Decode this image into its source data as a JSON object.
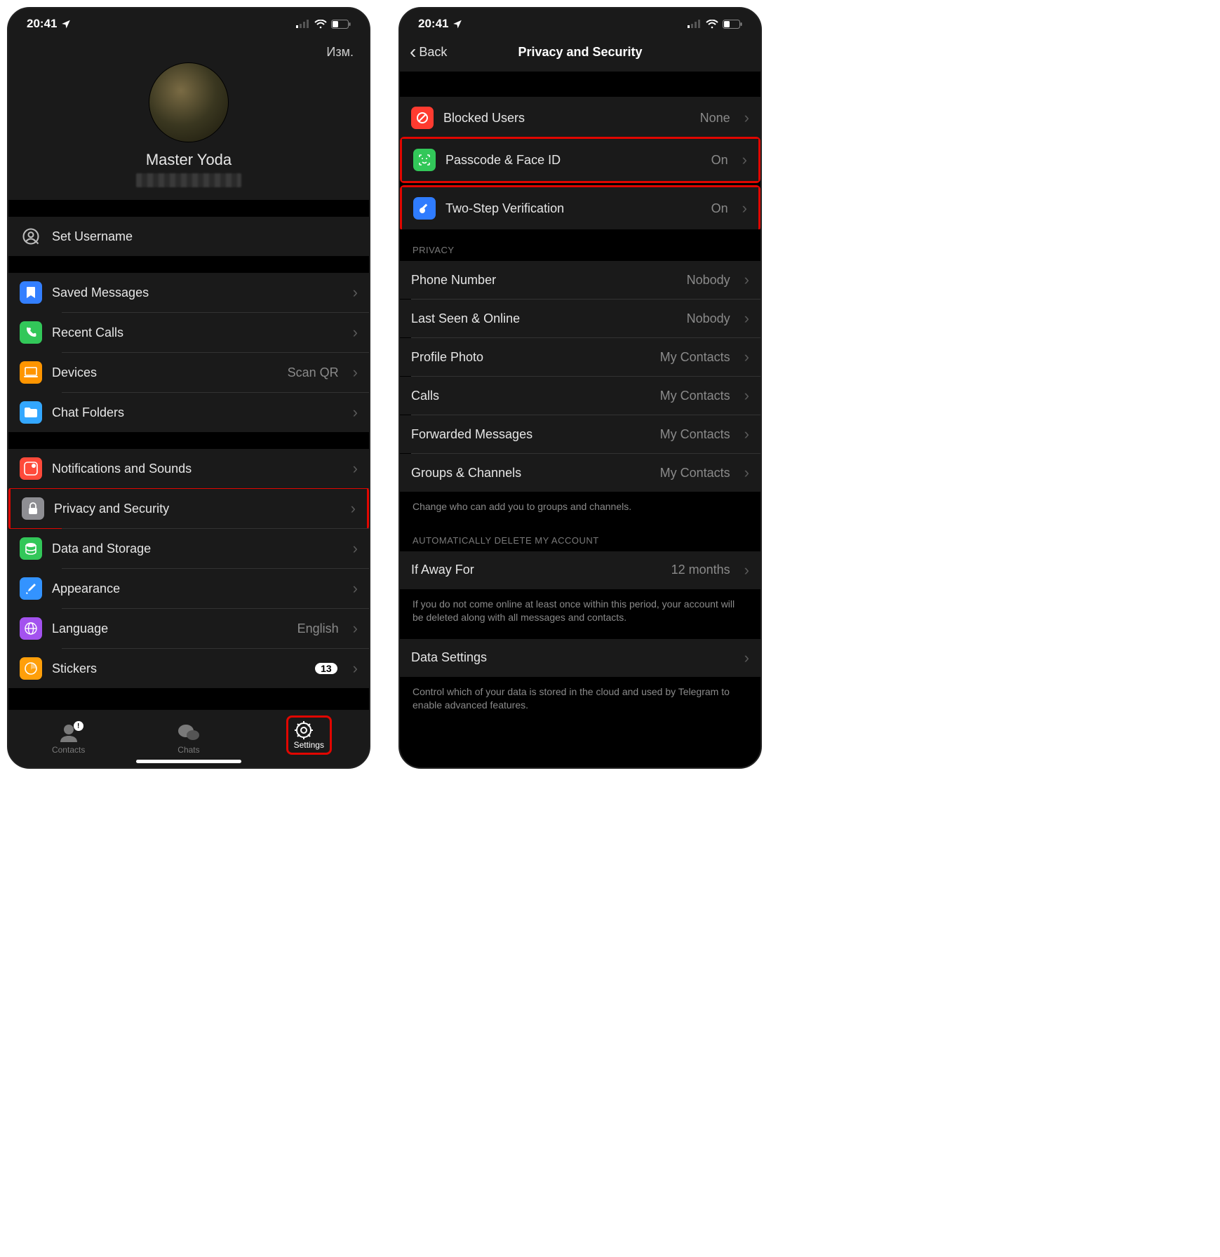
{
  "status": {
    "time": "20:41"
  },
  "left": {
    "edit": "Изм.",
    "display_name": "Master Yoda",
    "rows": {
      "username": "Set Username",
      "saved": "Saved Messages",
      "calls": "Recent Calls",
      "devices": "Devices",
      "devices_val": "Scan QR",
      "folders": "Chat Folders",
      "notif": "Notifications and Sounds",
      "privacy": "Privacy and Security",
      "data": "Data and Storage",
      "appearance": "Appearance",
      "language": "Language",
      "language_val": "English",
      "stickers": "Stickers",
      "stickers_badge": "13"
    },
    "tabs": {
      "contacts": "Contacts",
      "chats": "Chats",
      "settings": "Settings"
    }
  },
  "right": {
    "back": "Back",
    "title": "Privacy and Security",
    "security": {
      "blocked": "Blocked Users",
      "blocked_val": "None",
      "passcode": "Passcode & Face ID",
      "passcode_val": "On",
      "twostep": "Two-Step Verification",
      "twostep_val": "On"
    },
    "privacy_header": "PRIVACY",
    "privacy": {
      "phone": "Phone Number",
      "phone_val": "Nobody",
      "lastseen": "Last Seen & Online",
      "lastseen_val": "Nobody",
      "photo": "Profile Photo",
      "photo_val": "My Contacts",
      "calls": "Calls",
      "calls_val": "My Contacts",
      "fwd": "Forwarded Messages",
      "fwd_val": "My Contacts",
      "groups": "Groups & Channels",
      "groups_val": "My Contacts"
    },
    "privacy_footer": "Change who can add you to groups and channels.",
    "auto_header": "AUTOMATICALLY DELETE MY ACCOUNT",
    "auto": {
      "label": "If Away For",
      "value": "12 months"
    },
    "auto_footer": "If you do not come online at least once within this period, your account will be deleted along with all messages and contacts.",
    "data_settings": "Data Settings",
    "data_footer": "Control which of your data is stored in the cloud and used by Telegram to enable advanced features."
  }
}
